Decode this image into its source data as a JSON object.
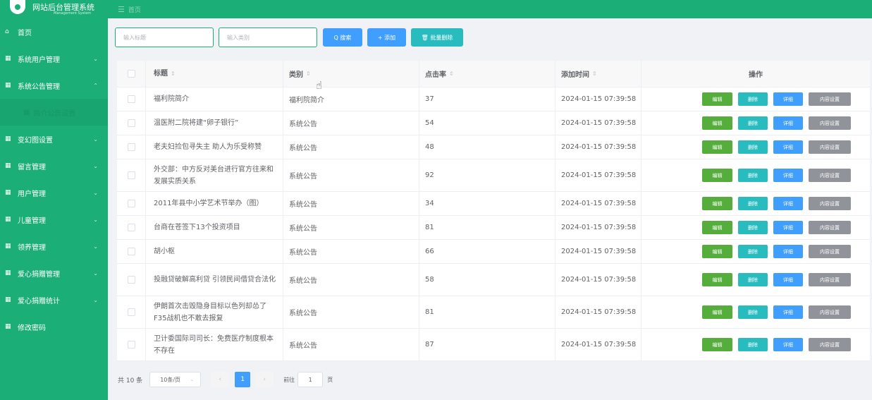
{
  "app": {
    "title": "网站后台管理系统",
    "subtitle": "Management System",
    "menu_toggle_icon": "menu-icon",
    "menu_toggle_text": "首页"
  },
  "sidebar": {
    "items": [
      {
        "label": "首页",
        "icon": "home-icon"
      },
      {
        "label": "系统用户管理",
        "icon": "grid-icon",
        "arrow": "⌄"
      },
      {
        "label": "系统公告管理",
        "icon": "grid-icon",
        "arrow": "⌃"
      },
      {
        "label": "简介公告设置",
        "icon": "grid-icon",
        "sub": true
      },
      {
        "label": "变幻图设置",
        "icon": "grid-icon",
        "arrow": "⌄"
      },
      {
        "label": "留言管理",
        "icon": "grid-icon",
        "arrow": "⌄"
      },
      {
        "label": "用户管理",
        "icon": "grid-icon",
        "arrow": "⌄"
      },
      {
        "label": "儿童管理",
        "icon": "grid-icon",
        "arrow": "⌄"
      },
      {
        "label": "领养管理",
        "icon": "grid-icon",
        "arrow": "⌄"
      },
      {
        "label": "爱心捐赠管理",
        "icon": "grid-icon",
        "arrow": "⌄"
      },
      {
        "label": "爱心捐赠统计",
        "icon": "grid-icon",
        "arrow": "⌄"
      },
      {
        "label": "修改密码",
        "icon": "grid-icon"
      }
    ]
  },
  "toolbar": {
    "title_placeholder": "输入标题",
    "category_placeholder": "输入类别",
    "search_label": "Q 搜索",
    "add_label": "+ 添加",
    "batch_delete_label": "🗑 批量删除"
  },
  "table": {
    "columns": [
      "标题",
      "类别",
      "点击率",
      "添加时间",
      "操作"
    ],
    "sort_icon": "⇕",
    "rows": [
      {
        "title": "福利院简介",
        "category": "福利院简介",
        "clicks": "37",
        "time": "2024-01-15 07:39:58"
      },
      {
        "title": "温医附二院将建“卵子银行”",
        "category": "系统公告",
        "clicks": "54",
        "time": "2024-01-15 07:39:58"
      },
      {
        "title": "老夫妇捡包寻失主 助人为乐受称赞",
        "category": "系统公告",
        "clicks": "48",
        "time": "2024-01-15 07:39:58"
      },
      {
        "title": "外交部：中方反对美台进行官方往来和发展实质关系",
        "category": "系统公告",
        "clicks": "92",
        "time": "2024-01-15 07:39:58"
      },
      {
        "title": "2011年县中小学艺术节举办（图）",
        "category": "系统公告",
        "clicks": "34",
        "time": "2024-01-15 07:39:58"
      },
      {
        "title": "台商在苍签下13个投资项目",
        "category": "系统公告",
        "clicks": "81",
        "time": "2024-01-15 07:39:58"
      },
      {
        "title": "胡小枢",
        "category": "系统公告",
        "clicks": "66",
        "time": "2024-01-15 07:39:58"
      },
      {
        "title": "投融贷破解高利贷 引领民间借贷合法化",
        "category": "系统公告",
        "clicks": "58",
        "time": "2024-01-15 07:39:58"
      },
      {
        "title": "伊朗首次击毁隐身目标以色列却怂了F35战机也不敢去报复",
        "category": "系统公告",
        "clicks": "81",
        "time": "2024-01-15 07:39:58"
      },
      {
        "title": "卫计委国际司司长：免费医疗制度根本不存在",
        "category": "系统公告",
        "clicks": "87",
        "time": "2024-01-15 07:39:58"
      }
    ],
    "ops": {
      "edit": "编辑",
      "delete": "删除",
      "detail": "详细",
      "content": "内容设置"
    }
  },
  "pager": {
    "total": "共 10 条",
    "page_size": "10条/页",
    "current_page": "1",
    "goto_label": "前往",
    "goto_value": "1",
    "page_unit": "页"
  },
  "colors": {
    "brand": "#1bae77",
    "primary": "#409eff",
    "success": "#55ad3b",
    "teal": "#29bcbf",
    "gray": "#909399"
  }
}
